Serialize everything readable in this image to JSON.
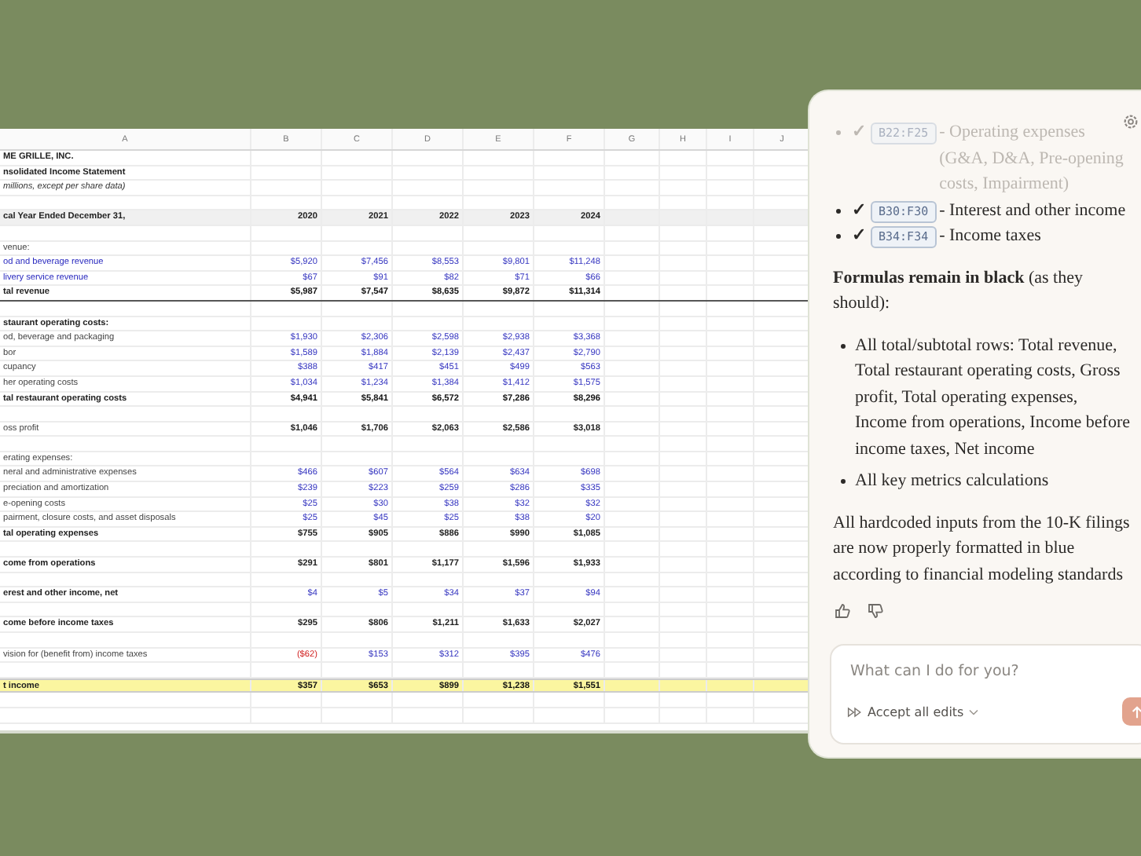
{
  "sheet": {
    "columns": [
      "A",
      "B",
      "C",
      "D",
      "E",
      "F",
      "G",
      "H",
      "I",
      "J"
    ],
    "rows": [
      {
        "label": "ME GRILLE, INC.",
        "kind": "title"
      },
      {
        "label": "nsolidated Income Statement",
        "kind": "title"
      },
      {
        "label": "millions, except per share data)",
        "kind": "note"
      },
      {
        "kind": "blank"
      },
      {
        "label": "cal Year Ended December 31,",
        "kind": "header",
        "cells": [
          {
            "v": "2020",
            "kind": "formula"
          },
          {
            "v": "2021",
            "kind": "formula"
          },
          {
            "v": "2022",
            "kind": "formula"
          },
          {
            "v": "2023",
            "kind": "formula"
          },
          {
            "v": "2024",
            "kind": "formula"
          }
        ]
      },
      {
        "kind": "blank"
      },
      {
        "label": "venue:",
        "kind": "item"
      },
      {
        "label": "od and beverage revenue",
        "kind": "input",
        "cells": [
          {
            "v": "$5,920",
            "kind": "input"
          },
          {
            "v": "$7,456",
            "kind": "input"
          },
          {
            "v": "$8,553",
            "kind": "input"
          },
          {
            "v": "$9,801",
            "kind": "input"
          },
          {
            "v": "$11,248",
            "kind": "input"
          }
        ]
      },
      {
        "label": "livery service revenue",
        "kind": "input",
        "cells": [
          {
            "v": "$67",
            "kind": "input"
          },
          {
            "v": "$91",
            "kind": "input"
          },
          {
            "v": "$82",
            "kind": "input"
          },
          {
            "v": "$71",
            "kind": "input"
          },
          {
            "v": "$66",
            "kind": "input"
          }
        ]
      },
      {
        "label": "tal revenue",
        "kind": "rule",
        "cells": [
          {
            "v": "$5,987",
            "kind": "total"
          },
          {
            "v": "$7,547",
            "kind": "total"
          },
          {
            "v": "$8,635",
            "kind": "total"
          },
          {
            "v": "$9,872",
            "kind": "total"
          },
          {
            "v": "$11,314",
            "kind": "total"
          }
        ]
      },
      {
        "kind": "blank"
      },
      {
        "label": "staurant operating costs:",
        "kind": "heading"
      },
      {
        "label": "od, beverage and packaging",
        "kind": "item",
        "cells": [
          {
            "v": "$1,930",
            "kind": "input"
          },
          {
            "v": "$2,306",
            "kind": "input"
          },
          {
            "v": "$2,598",
            "kind": "input"
          },
          {
            "v": "$2,938",
            "kind": "input"
          },
          {
            "v": "$3,368",
            "kind": "input"
          }
        ]
      },
      {
        "label": "bor",
        "kind": "item",
        "cells": [
          {
            "v": "$1,589",
            "kind": "input"
          },
          {
            "v": "$1,884",
            "kind": "input"
          },
          {
            "v": "$2,139",
            "kind": "input"
          },
          {
            "v": "$2,437",
            "kind": "input"
          },
          {
            "v": "$2,790",
            "kind": "input"
          }
        ]
      },
      {
        "label": "cupancy",
        "kind": "item",
        "cells": [
          {
            "v": "$388",
            "kind": "input"
          },
          {
            "v": "$417",
            "kind": "input"
          },
          {
            "v": "$451",
            "kind": "input"
          },
          {
            "v": "$499",
            "kind": "input"
          },
          {
            "v": "$563",
            "kind": "input"
          }
        ]
      },
      {
        "label": "her operating costs",
        "kind": "item",
        "cells": [
          {
            "v": "$1,034",
            "kind": "input"
          },
          {
            "v": "$1,234",
            "kind": "input"
          },
          {
            "v": "$1,384",
            "kind": "input"
          },
          {
            "v": "$1,412",
            "kind": "input"
          },
          {
            "v": "$1,575",
            "kind": "input"
          }
        ]
      },
      {
        "label": "tal restaurant operating costs",
        "kind": "total",
        "cells": [
          {
            "v": "$4,941",
            "kind": "total"
          },
          {
            "v": "$5,841",
            "kind": "total"
          },
          {
            "v": "$6,572",
            "kind": "total"
          },
          {
            "v": "$7,286",
            "kind": "total"
          },
          {
            "v": "$8,296",
            "kind": "total"
          }
        ]
      },
      {
        "kind": "blank"
      },
      {
        "label": "oss profit",
        "kind": "item",
        "cells": [
          {
            "v": "$1,046",
            "kind": "formula"
          },
          {
            "v": "$1,706",
            "kind": "formula"
          },
          {
            "v": "$2,063",
            "kind": "formula"
          },
          {
            "v": "$2,586",
            "kind": "formula"
          },
          {
            "v": "$3,018",
            "kind": "formula"
          }
        ]
      },
      {
        "kind": "blank"
      },
      {
        "label": "erating expenses:",
        "kind": "item"
      },
      {
        "label": "neral and administrative expenses",
        "kind": "item",
        "cells": [
          {
            "v": "$466",
            "kind": "input"
          },
          {
            "v": "$607",
            "kind": "input"
          },
          {
            "v": "$564",
            "kind": "input"
          },
          {
            "v": "$634",
            "kind": "input"
          },
          {
            "v": "$698",
            "kind": "input"
          }
        ]
      },
      {
        "label": "preciation and amortization",
        "kind": "item",
        "cells": [
          {
            "v": "$239",
            "kind": "input"
          },
          {
            "v": "$223",
            "kind": "input"
          },
          {
            "v": "$259",
            "kind": "input"
          },
          {
            "v": "$286",
            "kind": "input"
          },
          {
            "v": "$335",
            "kind": "input"
          }
        ]
      },
      {
        "label": "e-opening costs",
        "kind": "item",
        "cells": [
          {
            "v": "$25",
            "kind": "input"
          },
          {
            "v": "$30",
            "kind": "input"
          },
          {
            "v": "$38",
            "kind": "input"
          },
          {
            "v": "$32",
            "kind": "input"
          },
          {
            "v": "$32",
            "kind": "input"
          }
        ]
      },
      {
        "label": "pairment, closure costs, and asset disposals",
        "kind": "item",
        "cells": [
          {
            "v": "$25",
            "kind": "input"
          },
          {
            "v": "$45",
            "kind": "input"
          },
          {
            "v": "$25",
            "kind": "input"
          },
          {
            "v": "$38",
            "kind": "input"
          },
          {
            "v": "$20",
            "kind": "input"
          }
        ]
      },
      {
        "label": "tal operating expenses",
        "kind": "total",
        "cells": [
          {
            "v": "$755",
            "kind": "formula"
          },
          {
            "v": "$905",
            "kind": "formula"
          },
          {
            "v": "$886",
            "kind": "formula"
          },
          {
            "v": "$990",
            "kind": "formula"
          },
          {
            "v": "$1,085",
            "kind": "formula"
          }
        ]
      },
      {
        "kind": "blank"
      },
      {
        "label": "come from operations",
        "kind": "total",
        "cells": [
          {
            "v": "$291",
            "kind": "formula"
          },
          {
            "v": "$801",
            "kind": "formula"
          },
          {
            "v": "$1,177",
            "kind": "formula"
          },
          {
            "v": "$1,596",
            "kind": "formula"
          },
          {
            "v": "$1,933",
            "kind": "formula"
          }
        ]
      },
      {
        "kind": "blank"
      },
      {
        "label": "erest and other income, net",
        "kind": "total",
        "cells": [
          {
            "v": "$4",
            "kind": "input"
          },
          {
            "v": "$5",
            "kind": "input"
          },
          {
            "v": "$34",
            "kind": "input"
          },
          {
            "v": "$37",
            "kind": "input"
          },
          {
            "v": "$94",
            "kind": "input"
          }
        ]
      },
      {
        "kind": "blank"
      },
      {
        "label": "come before income taxes",
        "kind": "total",
        "cells": [
          {
            "v": "$295",
            "kind": "formula"
          },
          {
            "v": "$806",
            "kind": "formula"
          },
          {
            "v": "$1,211",
            "kind": "formula"
          },
          {
            "v": "$1,633",
            "kind": "formula"
          },
          {
            "v": "$2,027",
            "kind": "formula"
          }
        ]
      },
      {
        "kind": "blank"
      },
      {
        "label": "vision for (benefit from) income taxes",
        "kind": "item",
        "cells": [
          {
            "v": "($62)",
            "kind": "negative"
          },
          {
            "v": "$153",
            "kind": "input"
          },
          {
            "v": "$312",
            "kind": "input"
          },
          {
            "v": "$395",
            "kind": "input"
          },
          {
            "v": "$476",
            "kind": "input"
          }
        ]
      },
      {
        "kind": "blank"
      },
      {
        "label": "t income",
        "kind": "highlight",
        "cells": [
          {
            "v": "$357",
            "kind": "total"
          },
          {
            "v": "$653",
            "kind": "total"
          },
          {
            "v": "$899",
            "kind": "total"
          },
          {
            "v": "$1,238",
            "kind": "total"
          },
          {
            "v": "$1,551",
            "kind": "total"
          }
        ]
      },
      {
        "kind": "blank"
      },
      {
        "kind": "blank"
      }
    ]
  },
  "chat": {
    "checks": [
      {
        "mark": "✓",
        "range": "B22:F25",
        "text": "- Operating expenses (G&A, D&A, Pre-opening costs, Impairment)",
        "faded": true
      },
      {
        "mark": "✓",
        "range": "B30:F30",
        "text": "- Interest and other income",
        "faded": false
      },
      {
        "mark": "✓",
        "range": "B34:F34",
        "text": "- Income taxes",
        "faded": false
      }
    ],
    "heading": "**Formulas remain in black** (as they should):",
    "bullets": [
      "All total/subtotal rows: Total revenue, Total restaurant operating costs, Gross profit, Total operating expenses, Income from operations, Income before income taxes, Net income",
      "All key metrics calculations"
    ],
    "summary": "All hardcoded inputs from the 10-K filings are now properly formatted in blue according to financial modeling standards",
    "composer": {
      "placeholder": "What can I do for you?",
      "mode": "Accept all edits"
    }
  }
}
